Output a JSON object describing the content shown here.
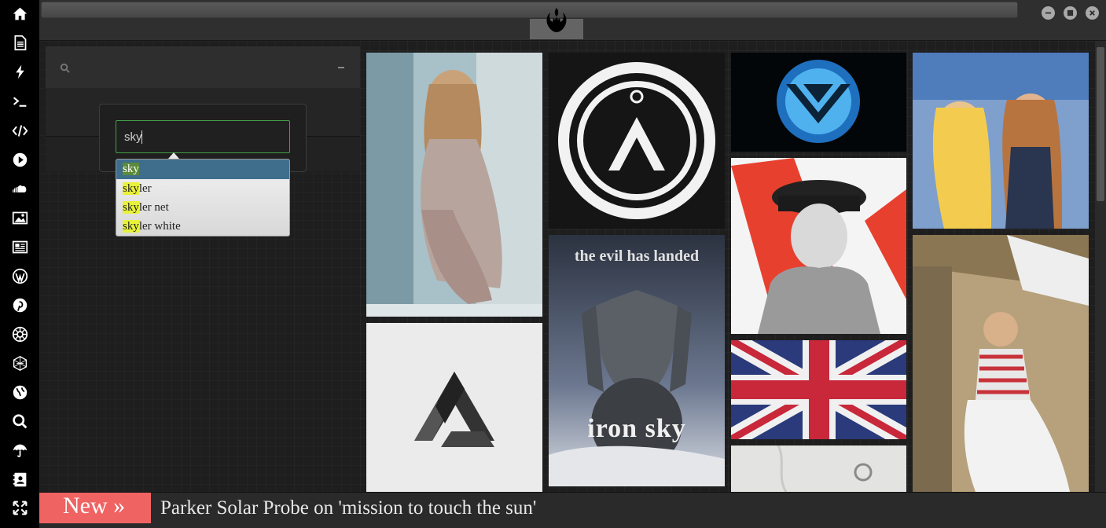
{
  "topbar": {
    "address_value": "",
    "logo_icon": "rebel-alliance-logo-icon",
    "window_buttons": [
      "minimize-icon",
      "maximize-icon",
      "close-icon"
    ]
  },
  "sidebar": {
    "items": [
      {
        "icon": "home-icon"
      },
      {
        "icon": "document-icon"
      },
      {
        "icon": "lightning-icon"
      },
      {
        "icon": "terminal-icon"
      },
      {
        "icon": "code-icon"
      },
      {
        "icon": "play-icon"
      },
      {
        "icon": "soundcloud-icon"
      },
      {
        "icon": "image-icon"
      },
      {
        "icon": "newspaper-icon"
      },
      {
        "icon": "wordpress-icon"
      },
      {
        "icon": "pinterest-icon"
      },
      {
        "icon": "galactic-empire-icon"
      },
      {
        "icon": "geometric-sphere-icon"
      },
      {
        "icon": "globe-icon"
      },
      {
        "icon": "search-icon"
      },
      {
        "icon": "umbrella-icon"
      },
      {
        "icon": "contact-card-icon"
      },
      {
        "icon": "fullscreen-icon"
      }
    ]
  },
  "search": {
    "value": "sky",
    "suggestions": [
      {
        "match": "sky",
        "rest": ""
      },
      {
        "match": "sky",
        "rest": "ler"
      },
      {
        "match": "sky",
        "rest": "ler net"
      },
      {
        "match": "sky",
        "rest": "ler white"
      }
    ]
  },
  "images": {
    "col2_poster_title": "the evil has landed",
    "col2_poster_logo": "iron sky"
  },
  "ticker": {
    "badge": "New »",
    "headline": "Parker Solar Probe on 'mission to touch the sun'"
  },
  "colors": {
    "accent_green": "#43a047",
    "ticker_badge": "#f06363",
    "suggestion_active": "#3f6d8c",
    "highlight": "#e8f23a"
  }
}
